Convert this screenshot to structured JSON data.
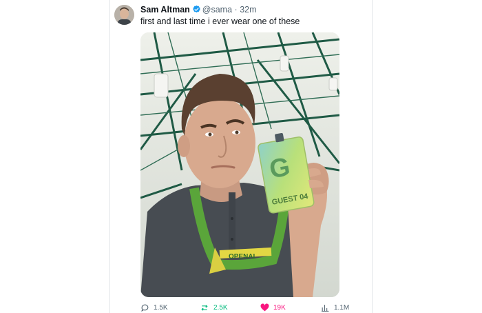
{
  "author": {
    "name": "Sam Altman",
    "handle": "@sama",
    "separator": "·",
    "time": "32m"
  },
  "tweet": {
    "text": "first and last time i ever wear one of these"
  },
  "media": {
    "badge_text": "GUEST 04",
    "lanyard_text": "OPENAI"
  },
  "actions": {
    "replies": "1.5K",
    "retweets": "2.5K",
    "likes": "19K",
    "views": "1.1M"
  },
  "colors": {
    "verified": "#1d9bf0",
    "retweet": "#00ba7c",
    "like": "#f91880",
    "muted": "#536471",
    "lanyard": "#5aa53a",
    "badge": "#a9d86e"
  },
  "icons": [
    "verified-badge-icon",
    "reply-icon",
    "retweet-icon",
    "heart-icon",
    "views-icon"
  ]
}
